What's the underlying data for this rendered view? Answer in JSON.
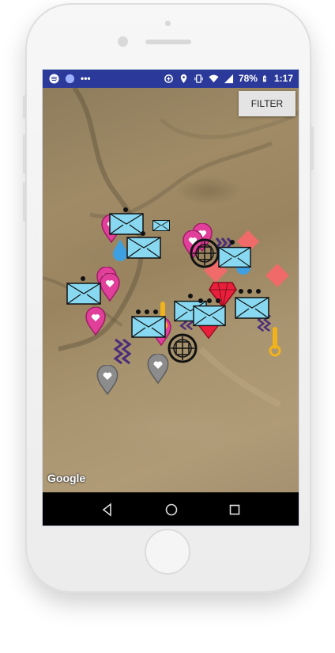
{
  "statusbar": {
    "battery": "78%",
    "time": "1:17",
    "dots": "•••"
  },
  "map": {
    "filter_label": "FILTER",
    "attribution": "Google",
    "markers": [
      {
        "type": "mail-icon"
      },
      {
        "type": "heart-pin-icon"
      },
      {
        "type": "crosshair-icon"
      },
      {
        "type": "diamond-icon"
      },
      {
        "type": "gem-icon"
      },
      {
        "type": "thermometer-icon"
      },
      {
        "type": "zigzag-icon"
      },
      {
        "type": "water-drop-icon"
      }
    ]
  },
  "colors": {
    "statusbar": "#2b3a9a",
    "mail": "#87d8f0",
    "heart_pin": "#e0409a",
    "diamond": "#f06a6a",
    "gem": "#e8203c",
    "grey_pin": "#8c8c8c",
    "thermometer": "#f2b21c",
    "zigzag": "#4b2d7a",
    "drop": "#3ea0e0"
  }
}
